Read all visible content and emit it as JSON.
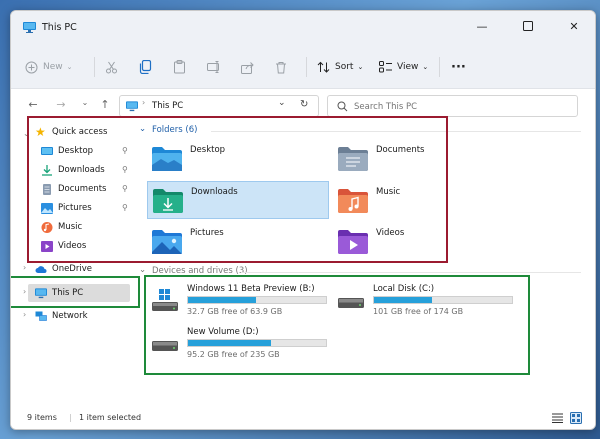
{
  "window": {
    "title": "This PC"
  },
  "toolbar": {
    "new_label": "New",
    "sort_label": "Sort",
    "view_label": "View",
    "more_label": "···"
  },
  "address": {
    "path": "This PC"
  },
  "search": {
    "placeholder": "Search This PC"
  },
  "sidebar": {
    "quick_access": "Quick access",
    "quick_items": [
      {
        "label": "Desktop",
        "icon": "desktop-icon",
        "pinned": true
      },
      {
        "label": "Downloads",
        "icon": "download-icon",
        "pinned": true
      },
      {
        "label": "Documents",
        "icon": "documents-icon",
        "pinned": true
      },
      {
        "label": "Pictures",
        "icon": "pictures-icon",
        "pinned": true
      },
      {
        "label": "Music",
        "icon": "music-icon",
        "pinned": false
      },
      {
        "label": "Videos",
        "icon": "videos-icon",
        "pinned": false
      }
    ],
    "onedrive": "OneDrive",
    "this_pc": "This PC",
    "network": "Network"
  },
  "folders": {
    "header": "Folders (6)",
    "items": [
      {
        "label": "Desktop",
        "icon": "desktop-folder-icon"
      },
      {
        "label": "Documents",
        "icon": "documents-folder-icon"
      },
      {
        "label": "Downloads",
        "icon": "downloads-folder-icon",
        "selected": true
      },
      {
        "label": "Music",
        "icon": "music-folder-icon"
      },
      {
        "label": "Pictures",
        "icon": "pictures-folder-icon"
      },
      {
        "label": "Videos",
        "icon": "videos-folder-icon"
      }
    ]
  },
  "drives": {
    "header": "Devices and drives (3)",
    "items": [
      {
        "name": "Windows 11 Beta Preview (B:)",
        "free": "32.7 GB free of 63.9 GB",
        "used_fraction": 0.49,
        "os_drive": true
      },
      {
        "name": "Local Disk (C:)",
        "free": "101 GB free of 174 GB",
        "used_fraction": 0.42,
        "os_drive": false
      },
      {
        "name": "New Volume (D:)",
        "free": "95.2 GB free of 235 GB",
        "used_fraction": 0.6,
        "os_drive": false
      }
    ]
  },
  "status": {
    "items": "9 items",
    "selected": "1 item selected"
  },
  "colors": {
    "accent": "#26a0da",
    "annotation_red": "#9b1b30",
    "annotation_green": "#1e8a3a"
  }
}
